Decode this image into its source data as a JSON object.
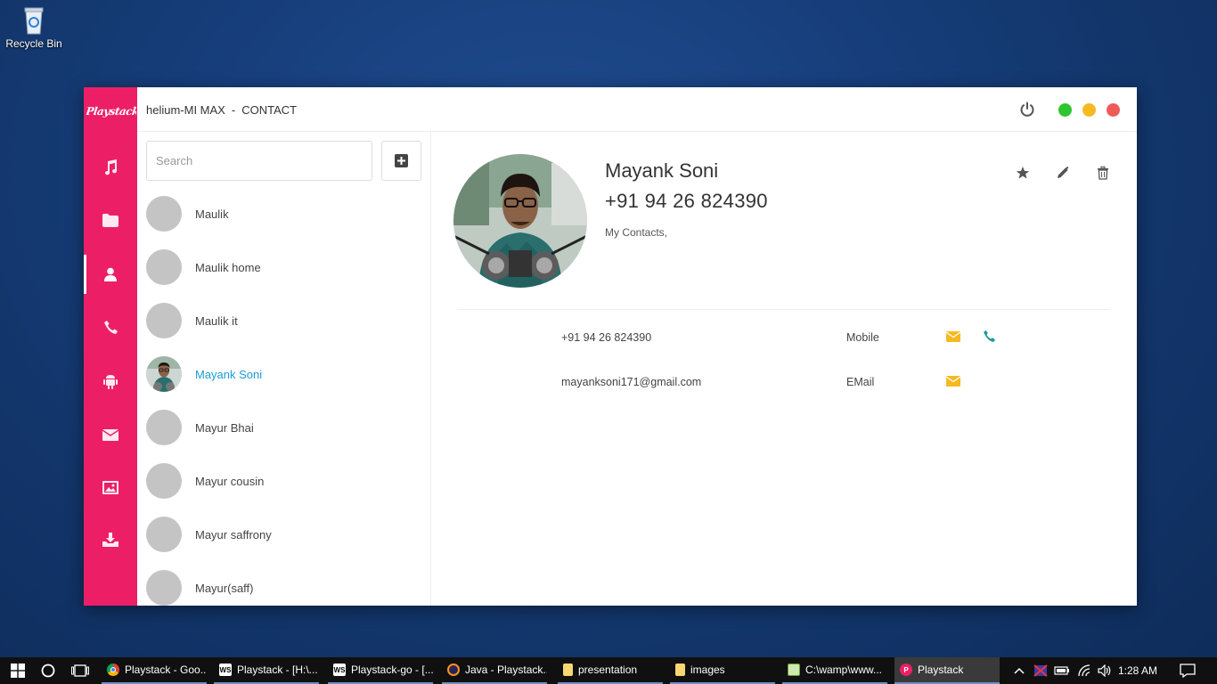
{
  "desktop": {
    "recycle_bin_label": "Recycle Bin"
  },
  "app": {
    "logo": "Playstack",
    "title_device": "helium-MI MAX",
    "title_separator": "-",
    "title_section": "CONTACT",
    "colors": {
      "sidebar": "#ec1f66",
      "green": "#2ec52e",
      "yellow": "#f5b922",
      "red": "#ee5a57",
      "accent_text": "#1a9bd7"
    }
  },
  "nav": [
    {
      "id": "music",
      "icon": "music-icon"
    },
    {
      "id": "files",
      "icon": "folder-icon"
    },
    {
      "id": "contacts",
      "icon": "user-icon",
      "active": true
    },
    {
      "id": "calls",
      "icon": "phone-icon"
    },
    {
      "id": "apps",
      "icon": "android-icon"
    },
    {
      "id": "messages",
      "icon": "envelope-icon"
    },
    {
      "id": "images",
      "icon": "image-icon"
    },
    {
      "id": "downloads",
      "icon": "download-icon"
    }
  ],
  "search": {
    "placeholder": "Search",
    "value": ""
  },
  "contacts": [
    {
      "name": "Maulik"
    },
    {
      "name": "Maulik home"
    },
    {
      "name": "Maulik it"
    },
    {
      "name": "Mayank Soni",
      "selected": true,
      "has_photo": true
    },
    {
      "name": "Mayur Bhai"
    },
    {
      "name": "Mayur cousin"
    },
    {
      "name": "Mayur saffrony"
    },
    {
      "name": "Mayur(saff)"
    }
  ],
  "detail": {
    "name": "Mayank Soni",
    "phone": "+91 94 26 824390",
    "groups": "My Contacts,",
    "entries": [
      {
        "value": "+91 94 26 824390",
        "type": "Mobile",
        "icons": [
          "envelope-icon",
          "phone-icon"
        ]
      },
      {
        "value": "mayanksoni171@gmail.com",
        "type": "EMail",
        "icons": [
          "envelope-icon"
        ]
      }
    ]
  },
  "taskbar": {
    "apps": [
      {
        "label": "Playstack - Goo...",
        "icon": "chrome-icon"
      },
      {
        "label": "Playstack - [H:\\...",
        "icon": "webstorm-icon"
      },
      {
        "label": "Playstack-go - [...",
        "icon": "webstorm-icon"
      },
      {
        "label": "Java - Playstack...",
        "icon": "eclipse-icon"
      },
      {
        "label": "presentation",
        "icon": "folder-icon"
      },
      {
        "label": "images",
        "icon": "folder-icon"
      },
      {
        "label": "C:\\wamp\\www...",
        "icon": "notepad-icon"
      },
      {
        "label": "Playstack",
        "icon": "playstack-icon",
        "active": true
      }
    ],
    "time": "1:28 AM"
  }
}
